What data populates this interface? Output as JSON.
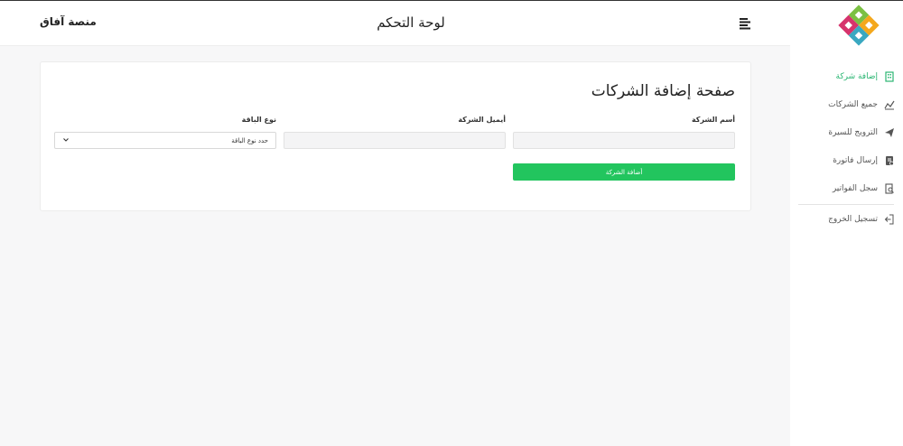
{
  "brand": {
    "name": "منصة آفاق"
  },
  "header": {
    "title": "لوحة التحكم"
  },
  "sidebar": {
    "items": [
      {
        "label": "إضافة شركة",
        "icon": "building-icon",
        "active": true
      },
      {
        "label": "جميع الشركات",
        "icon": "chart-icon",
        "active": false
      },
      {
        "label": "الترويج للسيرة",
        "icon": "paper-plane-icon",
        "active": false
      },
      {
        "label": "إرسال فاتورة",
        "icon": "invoice-icon",
        "active": false
      },
      {
        "label": "سجل الفواتير",
        "icon": "document-search-icon",
        "active": false
      }
    ],
    "logout": {
      "label": "تسجيل الخروج",
      "icon": "logout-icon"
    }
  },
  "page": {
    "title": "صفحة إضافة الشركات",
    "fields": {
      "company_name": {
        "label": "أسم الشركة",
        "value": ""
      },
      "company_email": {
        "label": "أيميل الشركة",
        "value": ""
      },
      "package_type": {
        "label": "نوع الباقة",
        "selected": "حدد نوع الباقة"
      }
    },
    "submit_label": "أضافة الشركة"
  },
  "colors": {
    "accent": "#22c55e",
    "active_nav": "#2bb673",
    "background": "#f7f7f8"
  }
}
